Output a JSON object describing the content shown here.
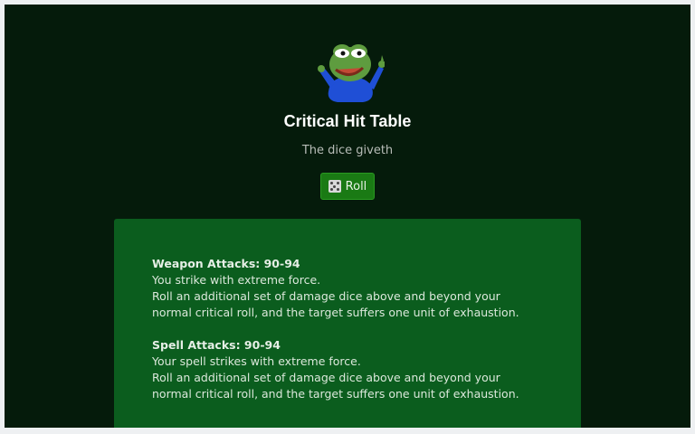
{
  "header": {
    "title": "Critical Hit Table",
    "subtitle": "The dice giveth",
    "roll_label": "Roll"
  },
  "mascot": {
    "icon": "pepe-frog-icon",
    "shirt_color": "#1f4fd6",
    "skin_color": "#5e9c3f"
  },
  "colors": {
    "background": "#051b0b",
    "card": "#0b5d1e",
    "button": "#1a7a14"
  },
  "results": [
    {
      "heading": "Weapon Attacks: 90-94",
      "line1": "You strike with extreme force.",
      "line2": "Roll an additional set of damage dice above and beyond your normal critical roll, and the target suffers one unit of exhaustion."
    },
    {
      "heading": "Spell Attacks: 90-94",
      "line1": "Your spell strikes with extreme force.",
      "line2": "Roll an additional set of damage dice above and beyond your normal critical roll, and the target suffers one unit of exhaustion."
    }
  ]
}
